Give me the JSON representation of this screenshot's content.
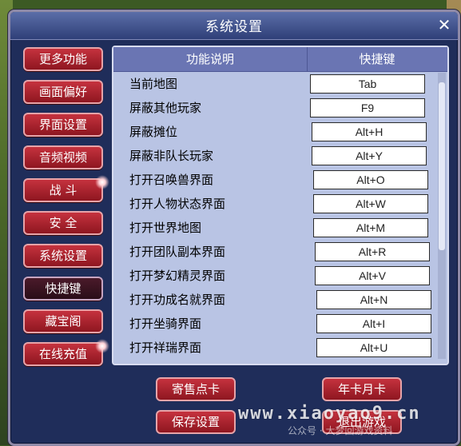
{
  "window": {
    "title": "系统设置"
  },
  "sidebar": {
    "items": [
      {
        "label": "更多功能"
      },
      {
        "label": "画面偏好"
      },
      {
        "label": "界面设置"
      },
      {
        "label": "音频视频"
      },
      {
        "label": "战 斗"
      },
      {
        "label": "安 全"
      },
      {
        "label": "系统设置"
      },
      {
        "label": "快捷键",
        "active": true
      },
      {
        "label": "藏宝阁"
      },
      {
        "label": "在线充值"
      }
    ]
  },
  "table": {
    "headers": {
      "desc": "功能说明",
      "key": "快捷键"
    },
    "rows": [
      {
        "label": "当前地图",
        "key": "Tab"
      },
      {
        "label": "屏蔽其他玩家",
        "key": "F9"
      },
      {
        "label": "屏蔽摊位",
        "key": "Alt+H"
      },
      {
        "label": "屏蔽非队长玩家",
        "key": "Alt+Y"
      },
      {
        "label": "打开召唤兽界面",
        "key": "Alt+O"
      },
      {
        "label": "打开人物状态界面",
        "key": "Alt+W"
      },
      {
        "label": "打开世界地图",
        "key": "Alt+M"
      },
      {
        "label": "打开团队副本界面",
        "key": "Alt+R"
      },
      {
        "label": "打开梦幻精灵界面",
        "key": "Alt+V"
      },
      {
        "label": "打开功成名就界面",
        "key": "Alt+N"
      },
      {
        "label": "打开坐骑界面",
        "key": "Alt+I"
      },
      {
        "label": "打开祥瑞界面",
        "key": "Alt+U"
      }
    ]
  },
  "footer": {
    "sell_card": "寄售点卡",
    "year_month_card": "年卡月卡",
    "save_settings": "保存设置",
    "exit_game": "退出游戏"
  },
  "watermark": {
    "site": "www.xiaoyao9.cn",
    "caption": "公众号 · 大梦回游戏资料"
  },
  "colors": {
    "accent_red": "#c5323e",
    "panel": "#b9c4e4",
    "header": "#6a75b3",
    "dialog": "#1f2d5a"
  }
}
